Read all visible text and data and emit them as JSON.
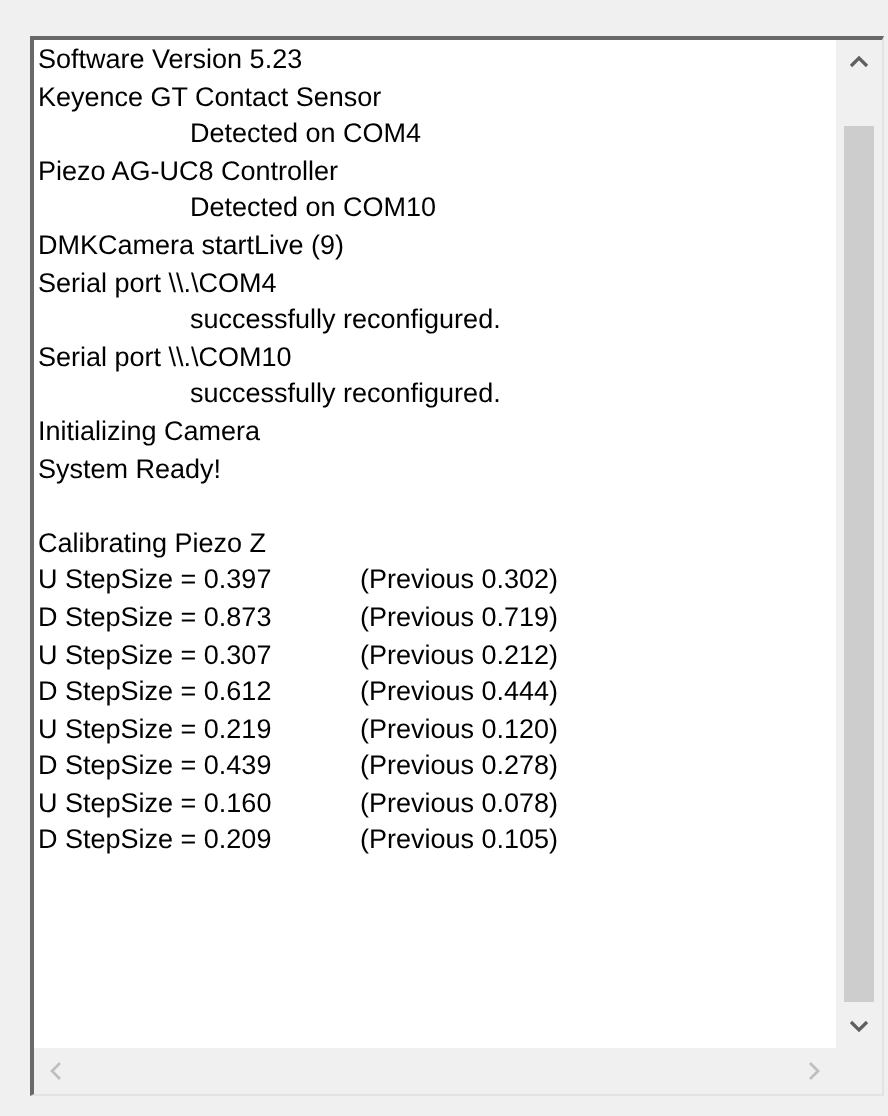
{
  "log": {
    "lines": [
      {
        "kind": "plain",
        "text": "Software Version 5.23"
      },
      {
        "kind": "plain",
        "text": "Keyence GT Contact Sensor"
      },
      {
        "kind": "indented",
        "text": "Detected on COM4"
      },
      {
        "kind": "plain",
        "text": "Piezo AG-UC8 Controller"
      },
      {
        "kind": "indented",
        "text": "Detected on COM10"
      },
      {
        "kind": "plain",
        "text": "DMKCamera startLive (9)"
      },
      {
        "kind": "plain",
        "text": "Serial port \\\\.\\COM4"
      },
      {
        "kind": "indented",
        "text": "successfully reconfigured."
      },
      {
        "kind": "plain",
        "text": "Serial port \\\\.\\COM10"
      },
      {
        "kind": "indented",
        "text": "successfully reconfigured."
      },
      {
        "kind": "plain",
        "text": "Initializing Camera"
      },
      {
        "kind": "plain",
        "text": "System Ready!"
      },
      {
        "kind": "blank"
      },
      {
        "kind": "plain",
        "text": "Calibrating Piezo Z"
      },
      {
        "kind": "step",
        "text": "U StepSize = 0.397",
        "previous": "(Previous 0.302)"
      },
      {
        "kind": "step",
        "text": "D StepSize = 0.873",
        "previous": "(Previous 0.719)"
      },
      {
        "kind": "step",
        "text": "U StepSize = 0.307",
        "previous": "(Previous 0.212)"
      },
      {
        "kind": "step",
        "text": "D StepSize = 0.612",
        "previous": "(Previous 0.444)"
      },
      {
        "kind": "step",
        "text": "U StepSize = 0.219",
        "previous": "(Previous 0.120)"
      },
      {
        "kind": "step",
        "text": "D StepSize = 0.439",
        "previous": "(Previous 0.278)"
      },
      {
        "kind": "step",
        "text": "U StepSize = 0.160",
        "previous": "(Previous 0.078)"
      },
      {
        "kind": "step",
        "text": "D StepSize = 0.209",
        "previous": "(Previous 0.105)"
      }
    ]
  }
}
